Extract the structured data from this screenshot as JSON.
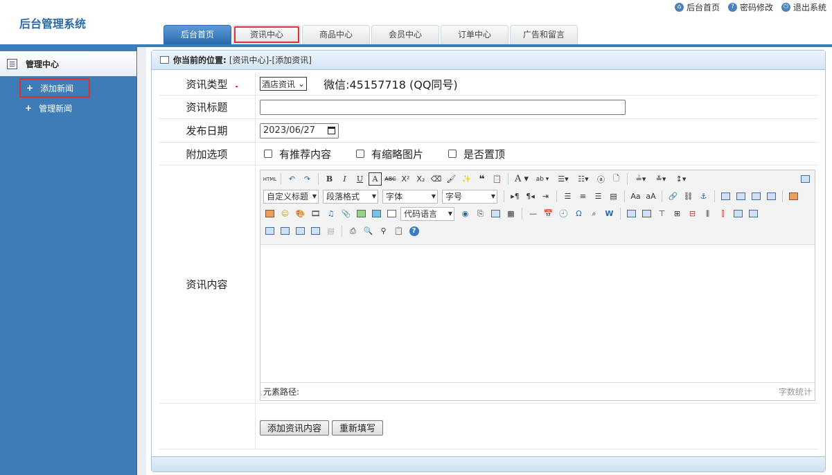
{
  "app": {
    "title": "后台管理系统"
  },
  "toplinks": [
    {
      "icon": "home-icon",
      "label": "后台首页"
    },
    {
      "icon": "help-icon",
      "label": "密码修改"
    },
    {
      "icon": "power-icon",
      "label": "退出系统"
    }
  ],
  "nav": {
    "tabs": [
      {
        "label": "后台首页",
        "active": true
      },
      {
        "label": "资讯中心",
        "highlighted": true
      },
      {
        "label": "商品中心"
      },
      {
        "label": "会员中心"
      },
      {
        "label": "订单中心"
      },
      {
        "label": "广告和留言"
      }
    ]
  },
  "sidebar": {
    "header": "管理中心",
    "items": [
      {
        "label": "添加新闻",
        "highlighted": true
      },
      {
        "label": "管理新闻"
      }
    ]
  },
  "breadcrumb": {
    "prefix": "你当前的位置:",
    "path": "[资讯中心]-[添加资讯]"
  },
  "form": {
    "type_label": "资讯类型",
    "type_value": "酒店资讯",
    "wechat": "微信:45157718 (QQ同号)",
    "title_label": "资讯标题",
    "title_value": "",
    "date_label": "发布日期",
    "date_value": "2023/06/27",
    "options_label": "附加选项",
    "options": [
      "有推荐内容",
      "有缩略图片",
      "是否置顶"
    ],
    "content_label": "资讯内容",
    "submit_label": "添加资讯内容",
    "reset_label": "重新填写"
  },
  "editor": {
    "combos": {
      "custom_title": "自定义标题",
      "paragraph": "段落格式",
      "font": "字体",
      "size": "字号",
      "code_lang": "代码语言"
    },
    "element_path": "元素路径:",
    "word_count": "字数统计"
  },
  "colors": {
    "brand": "#2a6aa8",
    "sidebar": "#3e7cb8",
    "highlight": "#e03030"
  }
}
